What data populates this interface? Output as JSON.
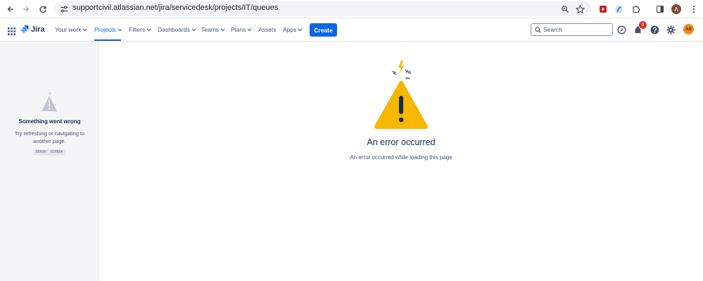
{
  "browser": {
    "url": "supportcivil.atlassian.net/jira/servicedesk/projects/IT/queues",
    "profile_initial": "A"
  },
  "header": {
    "logo_text": "Jira",
    "nav": [
      {
        "label": "Your work"
      },
      {
        "label": "Projects"
      },
      {
        "label": "Filters"
      },
      {
        "label": "Dashboards"
      },
      {
        "label": "Teams"
      },
      {
        "label": "Plans"
      },
      {
        "label": "Assets"
      },
      {
        "label": "Apps"
      }
    ],
    "create_label": "Create",
    "search_placeholder": "Search",
    "notification_count": "9",
    "avatar_initials": "AS"
  },
  "left_panel": {
    "title": "Something went wrong",
    "description": "Try refreshing or navigating to another page.",
    "error_code": "ERROR: USHBRA"
  },
  "main": {
    "title": "An error occurred",
    "description": "An error occurred while loading this page"
  },
  "colors": {
    "accent": "#0c66e4",
    "warning": "#f5b700",
    "notification": "#c9372c",
    "avatar": "#f18d13"
  }
}
